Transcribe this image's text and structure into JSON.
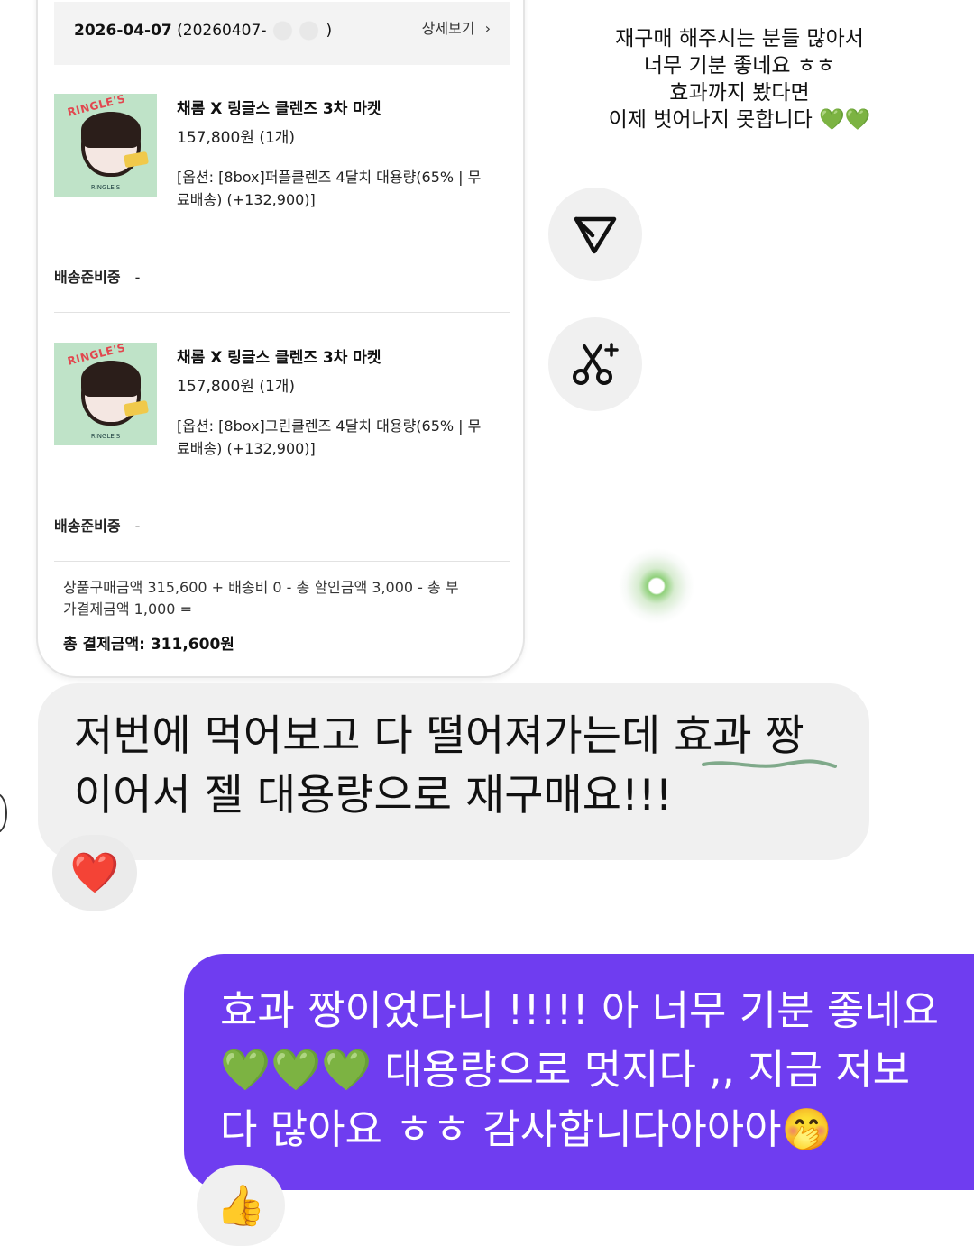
{
  "order_card": {
    "date": "2026-04-07",
    "order_no_prefix": "(20260407-",
    "order_no_suffix": ")",
    "detail_link": "상세보기",
    "items": [
      {
        "brand": "RINGLE'S",
        "title": "채롬 X 링글스 클렌즈 3차 마켓",
        "price": "157,800원 (1개)",
        "option": "[옵션: [8box]퍼플클렌즈 4달치 대용량(65% | 무료배송) (+132,900)]",
        "status_label": "배송준비중",
        "status_value": "-"
      },
      {
        "brand": "RINGLE'S",
        "title": "채롬 X 링글스 클렌즈 3차 마켓",
        "price": "157,800원 (1개)",
        "option": "[옵션: [8box]그린클렌즈 4달치 대용량(65% | 무료배송) (+132,900)]",
        "status_label": "배송준비중",
        "status_value": "-"
      }
    ],
    "summary": "상품구매금액 315,600 + 배송비 0 - 총 할인금액 3,000 - 총 부가결제금액 1,000 =",
    "total_label": "총 결제금액:",
    "total_value": "311,600원"
  },
  "overlay_text": {
    "line1": "재구매 해주시는 분들 많아서",
    "line2": "너무 기분 좋네요 ㅎㅎ",
    "line3": "효과까지 봤다면",
    "line4": "이제 벗어나지 못합니다 💚💚"
  },
  "buttons": {
    "send_icon": "paper-plane-icon",
    "effects_icon": "scissors-sparkle-icon"
  },
  "messages": {
    "incoming": {
      "line1": "저번에 먹어보고 다 떨어져가는데 효과 짱",
      "line2": "이어서 젤 대용량으로 재구매요!!!",
      "reaction": "❤️"
    },
    "outgoing": {
      "line1": "효과 짱이었다니 !!!!! 아 너무 기분 좋네요",
      "line2": "💚💚💚 대용량으로 멋지다 ,, 지금 저보",
      "line3": "다 많아요 ㅎㅎ 감사합니다아아아🤭",
      "reaction": "👍"
    }
  },
  "colors": {
    "outgoing_bubble": "#6f3df0",
    "incoming_bubble": "#f0f0f0",
    "underline_accent": "#7fa98a"
  }
}
